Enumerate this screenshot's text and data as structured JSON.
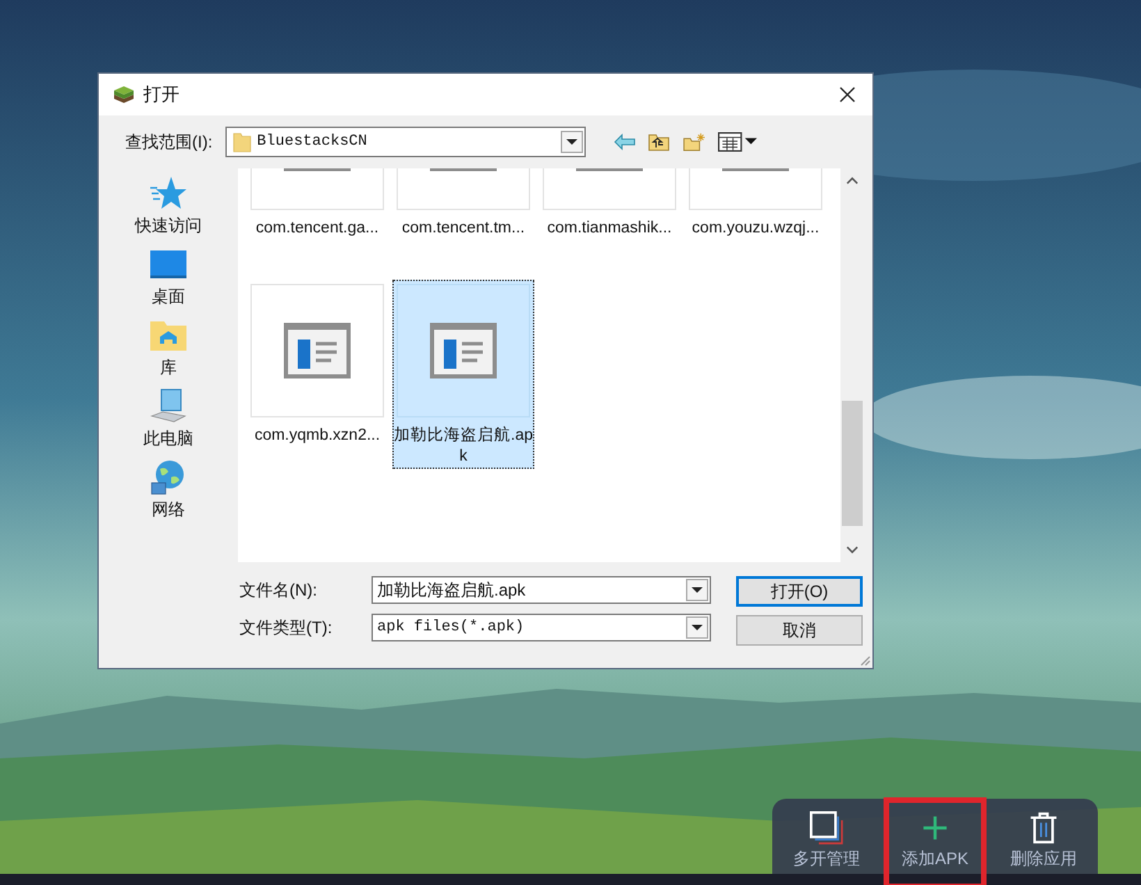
{
  "window": {
    "title": "打开"
  },
  "look_in": {
    "label": "查找范围(I):",
    "value": "BluestacksCN"
  },
  "places": [
    {
      "kind": "star",
      "label": "快速访问"
    },
    {
      "kind": "desktop",
      "label": "桌面"
    },
    {
      "kind": "library",
      "label": "库"
    },
    {
      "kind": "computer",
      "label": "此电脑"
    },
    {
      "kind": "network",
      "label": "网络"
    }
  ],
  "files": [
    {
      "name": "com.tencent.ga...",
      "selected": false
    },
    {
      "name": "com.tencent.tm...",
      "selected": false
    },
    {
      "name": "com.tianmashik...",
      "selected": false
    },
    {
      "name": "com.youzu.wzqj...",
      "selected": false
    },
    {
      "name": "com.yqmb.xzn2...",
      "selected": false
    },
    {
      "name": "加勒比海盗启航.apk",
      "selected": true
    }
  ],
  "file_name": {
    "label": "文件名(N):",
    "value": "加勒比海盗启航.apk"
  },
  "file_type": {
    "label": "文件类型(T):",
    "value": "apk files(*.apk)"
  },
  "buttons": [
    "打开(O)",
    "取消"
  ],
  "dock": [
    {
      "kind": "multi",
      "label": "多开管理",
      "highlighted": false
    },
    {
      "kind": "add",
      "label": "添加APK",
      "highlighted": true
    },
    {
      "kind": "delete",
      "label": "删除应用",
      "highlighted": false
    }
  ]
}
